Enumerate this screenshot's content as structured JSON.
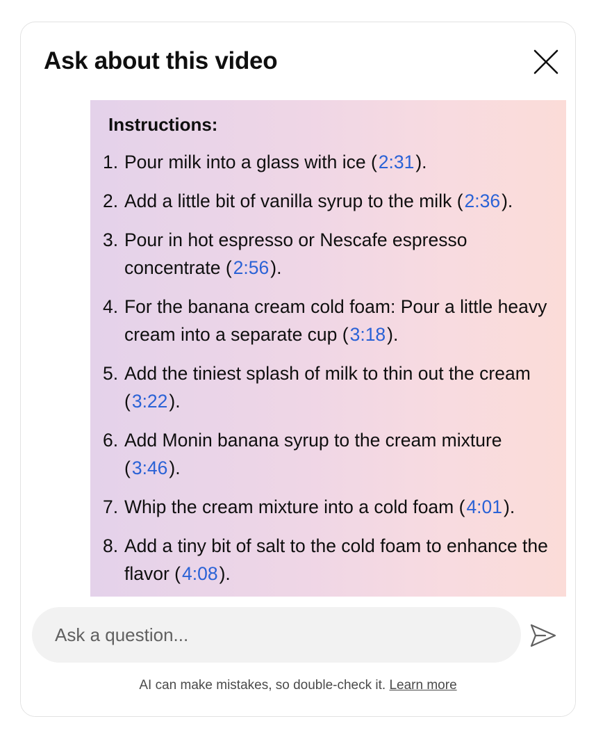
{
  "header": {
    "title": "Ask about this video"
  },
  "answer": {
    "heading": "Instructions:",
    "steps": [
      {
        "num": "1.",
        "text": "Pour milk into a glass with ice (",
        "ts": "2:31",
        "after": ")."
      },
      {
        "num": "2.",
        "text": "Add a little bit of vanilla syrup to the milk (",
        "ts": "2:36",
        "after": ")."
      },
      {
        "num": "3.",
        "text": "Pour in hot espresso or Nescafe espresso concentrate (",
        "ts": "2:56",
        "after": ")."
      },
      {
        "num": "4.",
        "text": "For the banana cream cold foam: Pour a little heavy cream into a separate cup (",
        "ts": "3:18",
        "after": ")."
      },
      {
        "num": "5.",
        "text": "Add the tiniest splash of milk to thin out the cream (",
        "ts": "3:22",
        "after": ")."
      },
      {
        "num": "6.",
        "text": "Add Monin banana syrup to the cream mixture (",
        "ts": "3:46",
        "after": ")."
      },
      {
        "num": "7.",
        "text": "Whip the cream mixture into a cold foam (",
        "ts": "4:01",
        "after": ")."
      },
      {
        "num": "8.",
        "text": "Add a tiny bit of salt to the cold foam to enhance the flavor (",
        "ts": "4:08",
        "after": ")."
      }
    ]
  },
  "input": {
    "placeholder": "Ask a question...",
    "value": ""
  },
  "footer": {
    "disclaimer": "AI can make mistakes, so double-check it.",
    "learn_more": "Learn more"
  },
  "icons": {
    "close": "close-icon",
    "send": "send-icon"
  },
  "colors": {
    "timestamp_link": "#2a62d6",
    "input_bg": "#f2f2f2"
  }
}
